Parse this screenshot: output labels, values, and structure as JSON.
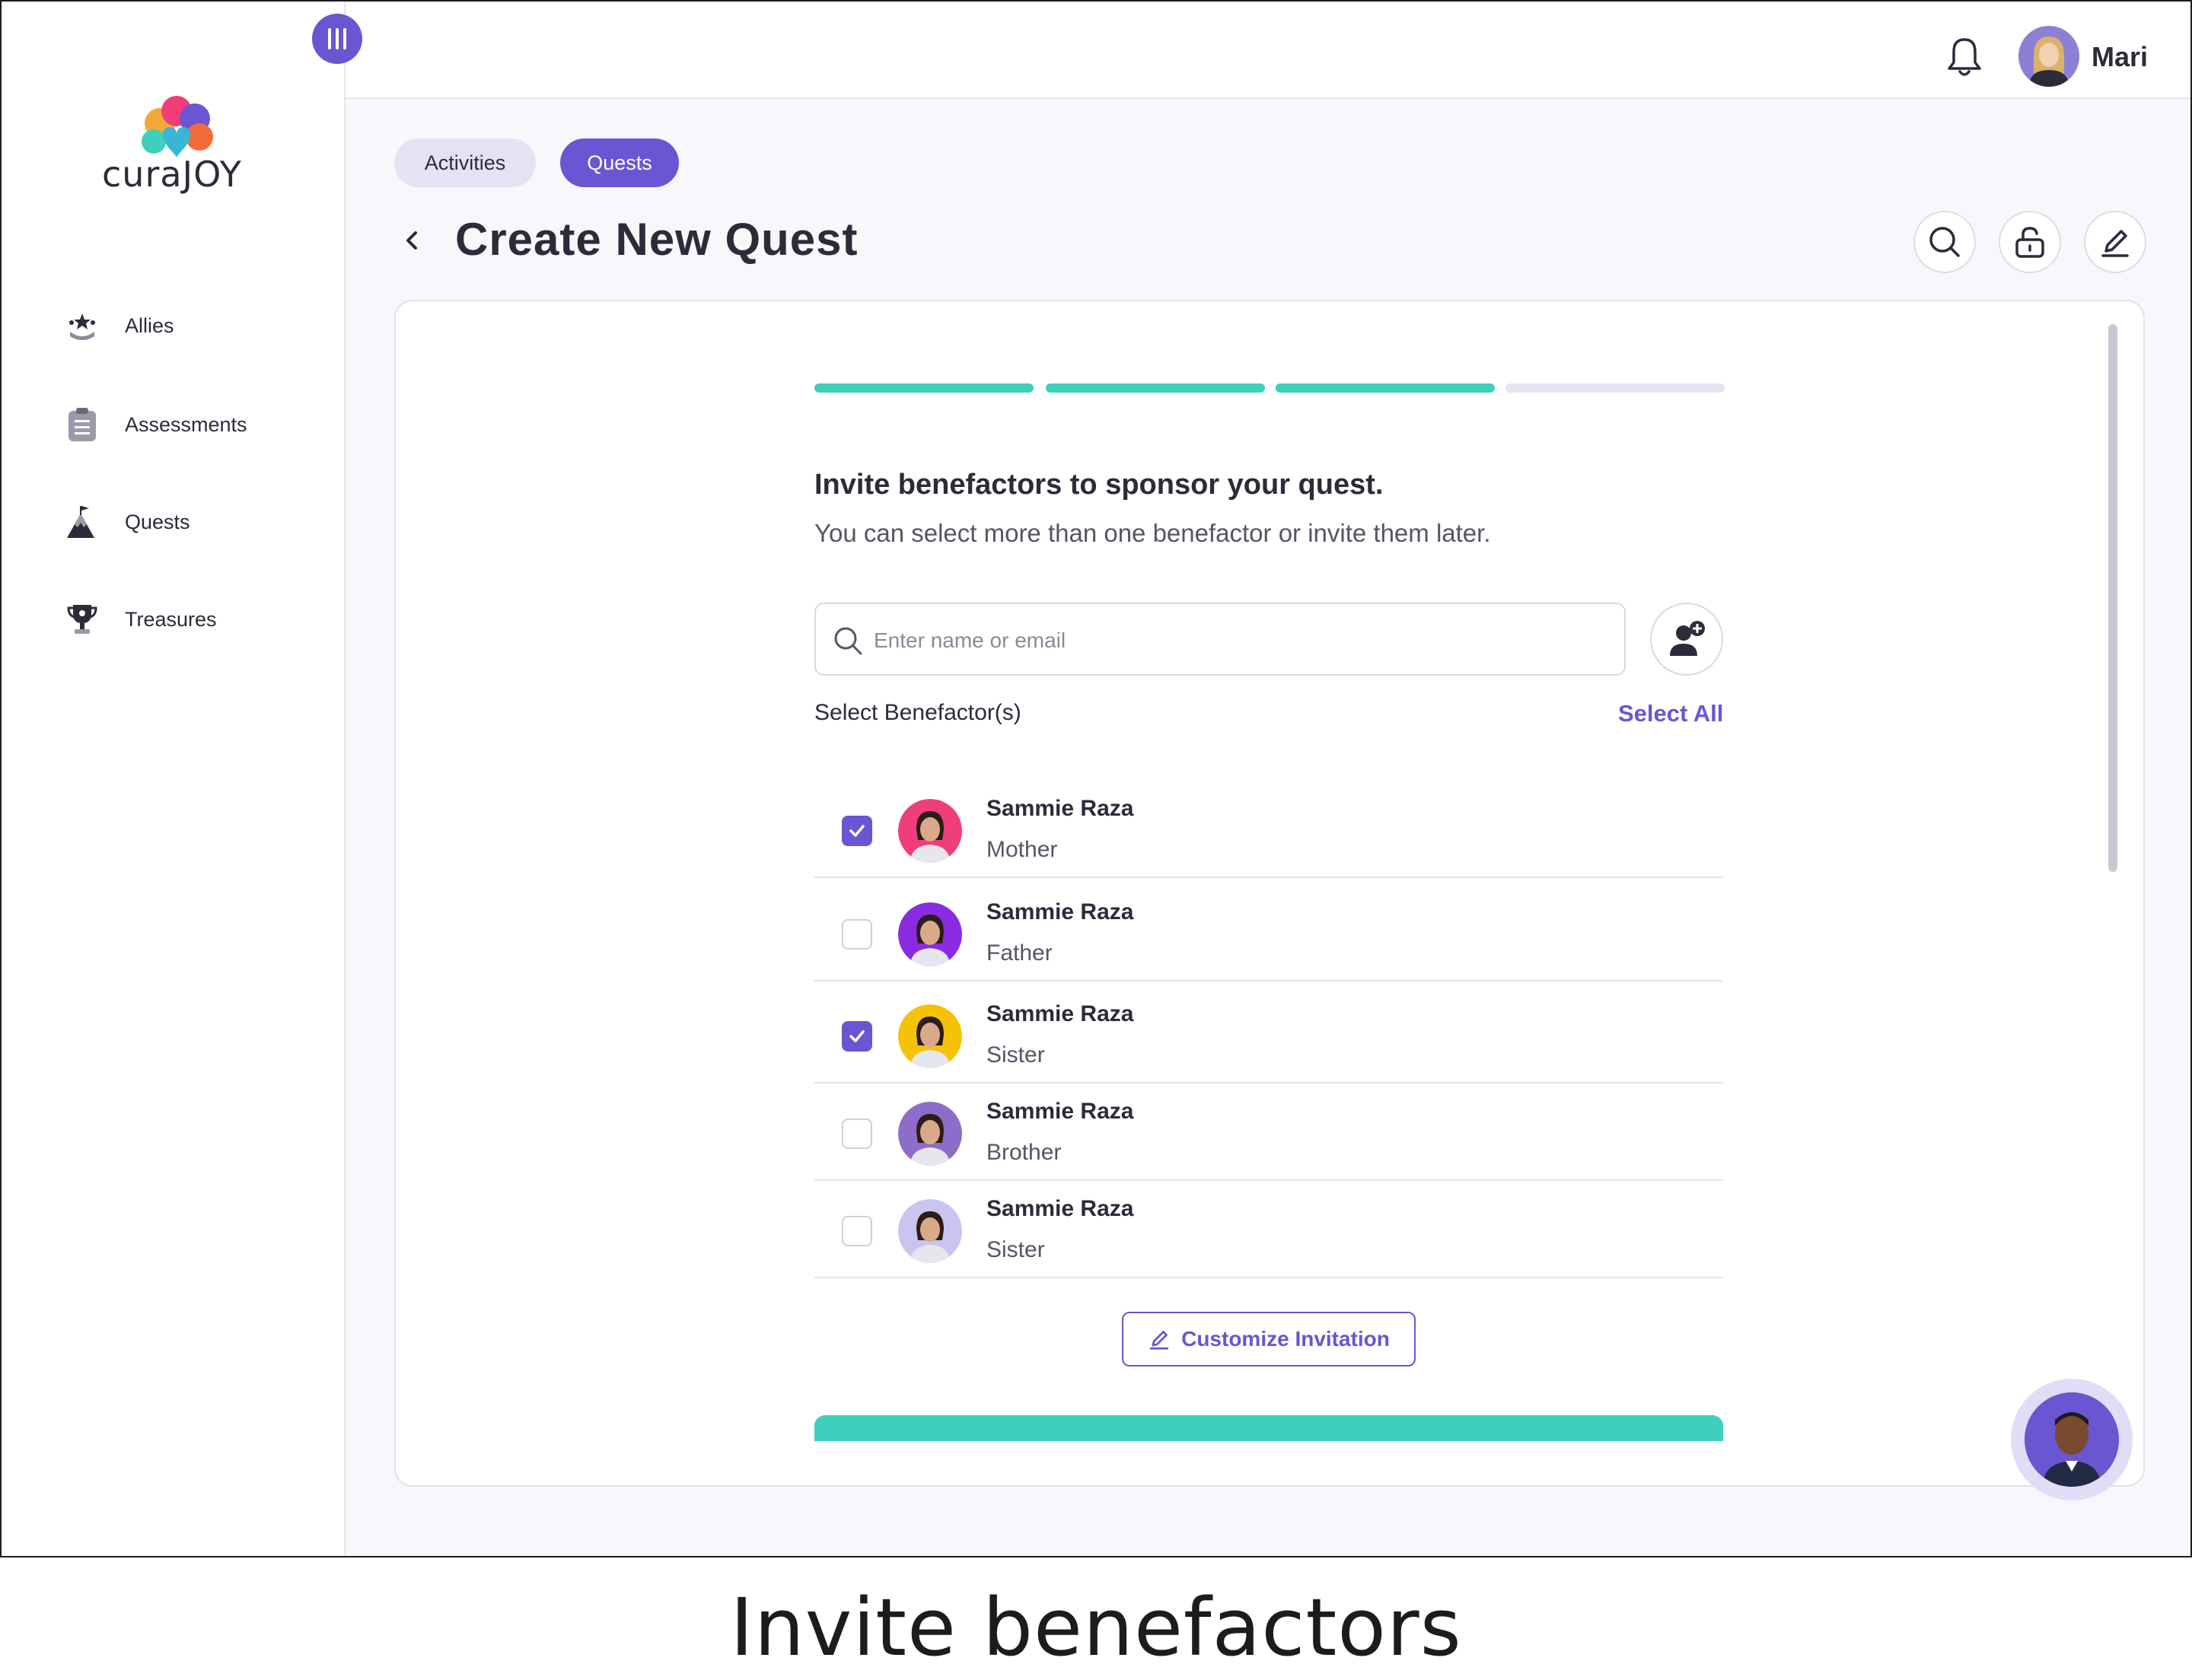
{
  "app": {
    "logo_text": "curaJOY"
  },
  "sidebar": {
    "items": [
      {
        "label": "Allies",
        "icon": "allies-icon"
      },
      {
        "label": "Assessments",
        "icon": "clipboard-icon"
      },
      {
        "label": "Quests",
        "icon": "mountain-flag-icon"
      },
      {
        "label": "Treasures",
        "icon": "trophy-icon"
      }
    ]
  },
  "header": {
    "user_name": "Mari",
    "notification_icon": "bell-icon"
  },
  "tabs": [
    {
      "label": "Activities",
      "active": false
    },
    {
      "label": "Quests",
      "active": true
    }
  ],
  "page": {
    "title": "Create New Quest"
  },
  "progress": {
    "steps_total": 4,
    "steps_completed": 3
  },
  "form": {
    "heading": "Invite benefactors to sponsor your quest.",
    "subheading": "You can select more than one benefactor or invite them later.",
    "search_placeholder": "Enter name or email",
    "select_label": "Select Benefactor(s)",
    "select_all": "Select All",
    "customize_label": "Customize Invitation"
  },
  "benefactors": [
    {
      "name": "Sammie Raza",
      "relation": "Mother",
      "checked": true,
      "color": "#ef3e7a"
    },
    {
      "name": "Sammie Raza",
      "relation": "Father",
      "checked": false,
      "color": "#8a2be2"
    },
    {
      "name": "Sammie Raza",
      "relation": "Sister",
      "checked": true,
      "color": "#f5c20a"
    },
    {
      "name": "Sammie Raza",
      "relation": "Brother",
      "checked": false,
      "color": "#8e6cc9"
    },
    {
      "name": "Sammie Raza",
      "relation": "Sister",
      "checked": false,
      "color": "#cbc4f0"
    }
  ],
  "colors": {
    "accent": "#6a55d3",
    "teal": "#3ecfbd",
    "track": "#e5e3f2"
  },
  "caption": "Invite benefactors"
}
